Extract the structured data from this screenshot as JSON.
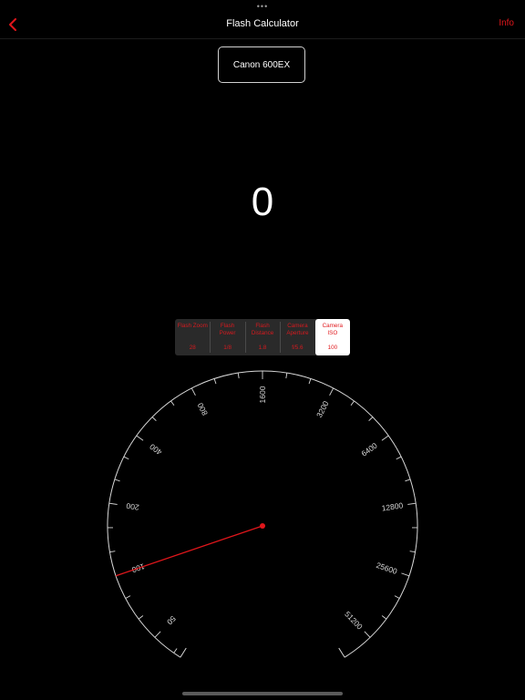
{
  "nav": {
    "title": "Flash Calculator",
    "info_label": "Info",
    "top_dots": "•••"
  },
  "device": {
    "label": "Canon 600EX"
  },
  "result": {
    "value": "0"
  },
  "segments": [
    {
      "label": "Flash Zoom",
      "value": "28",
      "active": false
    },
    {
      "label": "Flash Power",
      "value": "1/8",
      "active": false
    },
    {
      "label": "Flash Distance",
      "value": "1.8",
      "active": false
    },
    {
      "label": "Camera Aperture",
      "value": "f/5.6",
      "active": false
    },
    {
      "label": "Camera ISO",
      "value": "100",
      "active": true
    }
  ],
  "dial": {
    "labels": [
      "50",
      "100",
      "200",
      "400",
      "800",
      "1600",
      "3200",
      "6400",
      "12800",
      "25600",
      "51200"
    ],
    "selected": "100"
  },
  "colors": {
    "accent": "#e0161b",
    "background": "#000000",
    "dial_line": "#d8d8d8"
  }
}
